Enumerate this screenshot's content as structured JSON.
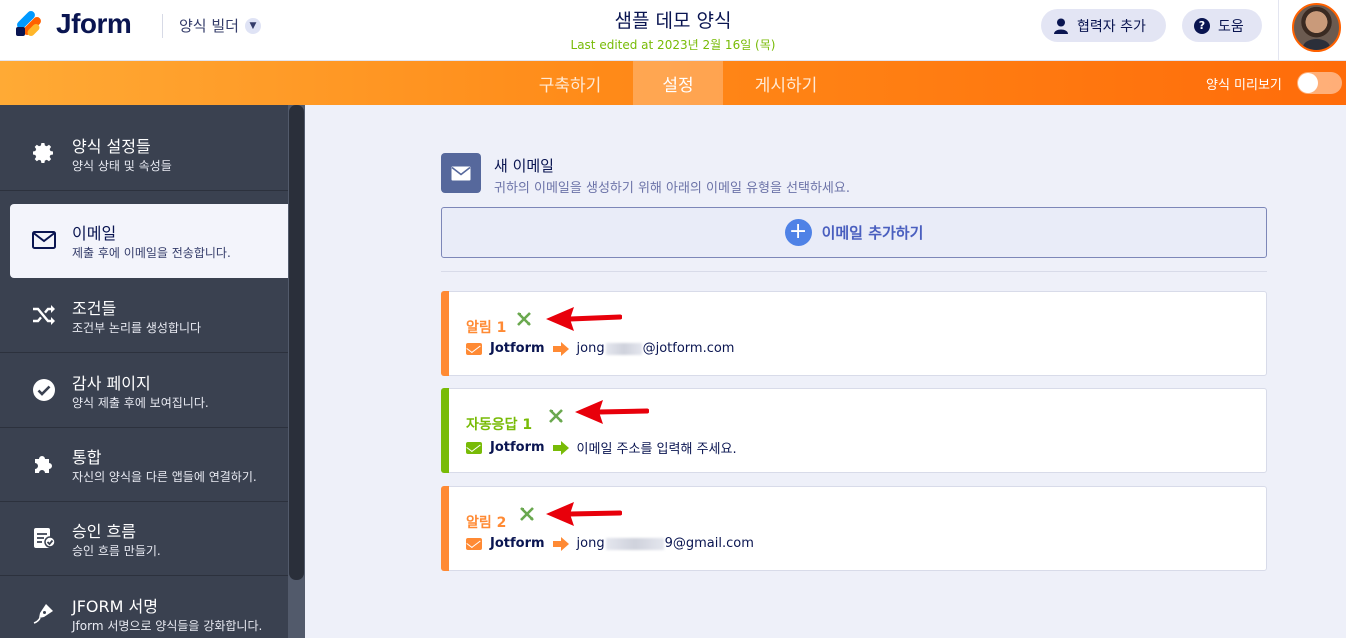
{
  "header": {
    "logo_text": "Jform",
    "builder_menu": "양식 빌더",
    "form_title": "샘플 데모 양식",
    "last_edited": "Last edited at 2023년 2월 16일 (목)",
    "add_collaborator": "협력자 추가",
    "help": "도움"
  },
  "nav": {
    "tabs": [
      {
        "label": "구축하기",
        "active": false
      },
      {
        "label": "설정",
        "active": true
      },
      {
        "label": "게시하기",
        "active": false
      }
    ],
    "preview_label": "양식 미리보기",
    "preview_on": false
  },
  "sidebar": {
    "items": [
      {
        "title": "양식 설정들",
        "subtitle": "양식 상태 및 속성들",
        "icon": "gear-icon"
      },
      {
        "title": "이메일",
        "subtitle": "제출 후에 이메일을 전송합니다.",
        "icon": "envelope-icon",
        "active": true
      },
      {
        "title": "조건들",
        "subtitle": "조건부 논리를 생성합니다",
        "icon": "shuffle-icon"
      },
      {
        "title": "감사 페이지",
        "subtitle": "양식 제출 후에 보여집니다.",
        "icon": "check-circle-icon"
      },
      {
        "title": "통합",
        "subtitle": "자신의 양식을 다른 앱들에 연결하기.",
        "icon": "puzzle-icon"
      },
      {
        "title": "승인 흐름",
        "subtitle": "승인 흐름 만들기.",
        "icon": "approval-icon"
      },
      {
        "title": "JFORM 서명",
        "subtitle": "Jform 서명으로 양식들을 강화합니다.",
        "icon": "pen-icon"
      }
    ]
  },
  "main": {
    "new_email_title": "새 이메일",
    "new_email_desc": "귀하의 이메일을 생성하기 위해 아래의 이메일 유형을 선택하세요.",
    "add_email_label": "이메일 추가하기",
    "emails": [
      {
        "name": "알림 1",
        "from": "Jotform",
        "to_prefix": "jong",
        "to_suffix": "@jotform.com",
        "color": "#ff8a34"
      },
      {
        "name": "자동응답 1",
        "from": "Jotform",
        "to_placeholder": "이메일 주소를 입력해 주세요.",
        "color": "#78bb07"
      },
      {
        "name": "알림 2",
        "from": "Jotform",
        "to_prefix": "jong",
        "to_suffix": "9@gmail.com",
        "color": "#ff8a34"
      }
    ]
  },
  "colors": {
    "orange": "#ff8a34",
    "green": "#78bb07",
    "annotation_red": "#e8000b"
  }
}
